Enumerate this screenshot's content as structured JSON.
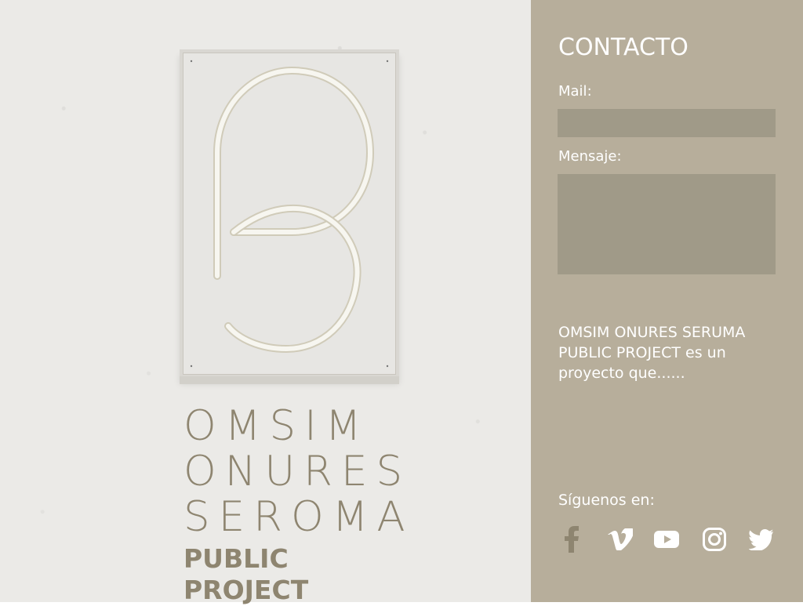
{
  "page": {
    "colors": {
      "left_background": "#ebeae7",
      "sidebar_background": "#b7ae9b",
      "field_background": "#a09a88",
      "brand_text": "#8e8570",
      "white": "#ffffff"
    }
  },
  "logo": {
    "monogram_icon": "ps-monogram-icon",
    "lines": [
      "OMSIM",
      "ONURES",
      "SEROMA"
    ],
    "subtitle": "PUBLIC PROJECT"
  },
  "sidebar": {
    "title": "CONTACTO",
    "mail_label": "Mail:",
    "mail_value": "",
    "message_label": "Mensaje:",
    "message_value": "",
    "description": "OMSIM ONURES SERUMA PUBLIC PROJECT es un proyecto que......",
    "follow_label": "Síguenos en:",
    "social": [
      {
        "name": "facebook",
        "icon": "facebook-icon"
      },
      {
        "name": "vimeo",
        "icon": "vimeo-icon"
      },
      {
        "name": "youtube",
        "icon": "youtube-icon"
      },
      {
        "name": "instagram",
        "icon": "instagram-icon"
      },
      {
        "name": "twitter",
        "icon": "twitter-icon"
      }
    ]
  }
}
